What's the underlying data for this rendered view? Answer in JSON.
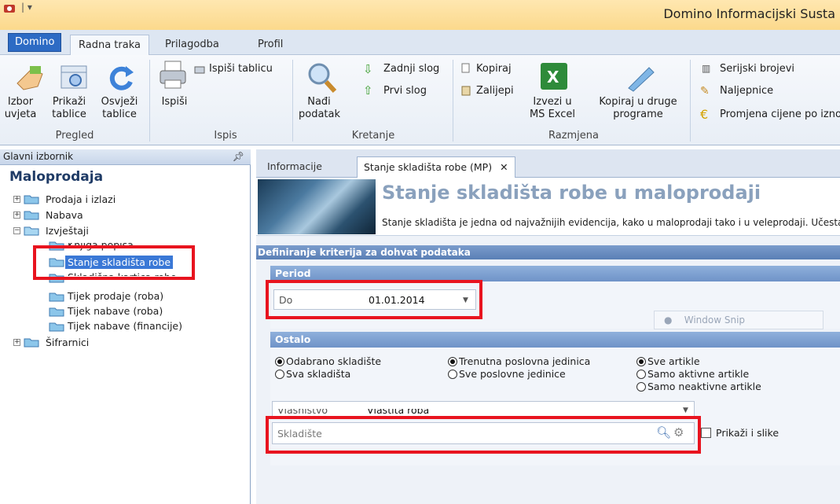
{
  "window": {
    "title": "Domino Informacijski Susta"
  },
  "ribbon_tabs": [
    {
      "label": "Domino"
    },
    {
      "label": "Radna traka"
    },
    {
      "label": "Prilagodba"
    },
    {
      "label": "Profil"
    }
  ],
  "ribbon": {
    "groups": {
      "pregled": "Pregled",
      "ispis": "Ispis",
      "kretanje": "Kretanje",
      "razmjena": "Razmjena"
    },
    "buttons": {
      "izbor_uvjeta": "Izbor\nuvjeta",
      "prikazi_tablice": "Prikaži\ntablice",
      "osvjezi_tablice": "Osvježi\ntablice",
      "ispisi_tablicu": "Ispiši tablicu",
      "ispisi": "Ispiši",
      "nadi_podatak": "Nađi\npodatak",
      "zadnji_slog": "Zadnji slog",
      "prvi_slog": "Prvi slog",
      "kopiraj": "Kopiraj",
      "zalijepi": "Zalijepi",
      "izvezi_excel": "Izvezi u\nMS Excel",
      "kopiraj_druge": "Kopiraj u druge\nprograme",
      "serijski_brojevi": "Serijski brojevi",
      "naljepnice": "Naljepnice",
      "promjena_cijene": "Promjena cijene po izno"
    }
  },
  "sidebar": {
    "header": "Glavni izbornik",
    "title": "Maloprodaja",
    "tree": [
      {
        "label": "Prodaja i izlazi"
      },
      {
        "label": "Nabava"
      },
      {
        "label": "Izvještaji"
      },
      {
        "label": "Knjiga popisa"
      },
      {
        "label": "Stanje skladišta robe"
      },
      {
        "label": "Skladišna kartica robe"
      },
      {
        "label": "Tijek prodaje (roba)"
      },
      {
        "label": "Tijek nabave (roba)"
      },
      {
        "label": "Tijek nabave (financije)"
      },
      {
        "label": "Šifrarnici"
      }
    ]
  },
  "doc_tabs": [
    {
      "label": "Informacije"
    },
    {
      "label": "Stanje skladišta robe (MP)"
    }
  ],
  "banner": {
    "title": "Stanje skladišta robe u maloprodaji",
    "text": "Stanje skladišta je jedna od najvažnijih evidencija, kako u maloprodaji tako i u veleprodaji. Učestali"
  },
  "criteria": {
    "header": "Definiranje kriterija za dohvat podataka",
    "period": {
      "title": "Period",
      "label": "Do",
      "value": "01.01.2014"
    },
    "ostalo": {
      "title": "Ostalo",
      "skladiste_opts": [
        "Odabrano skladište",
        "Sva skladišta"
      ],
      "jedinica_opts": [
        "Trenutna poslovna jedinica",
        "Sve poslovne jedinice"
      ],
      "artikli_opts": [
        "Sve artikle",
        "Samo aktivne artikle",
        "Samo neaktivne artikle"
      ],
      "vlasnistvo_label": "Vlasništvo",
      "vlasnistvo_value": "Vlastita roba",
      "skladiste_placeholder": "Skladište",
      "prikazi_slike": "Prikaži i slike"
    },
    "window_snip": "Window Snip"
  },
  "colors": {
    "highlight": "#e8141f",
    "selection": "#3a78d6",
    "section": "#6f93c8"
  }
}
